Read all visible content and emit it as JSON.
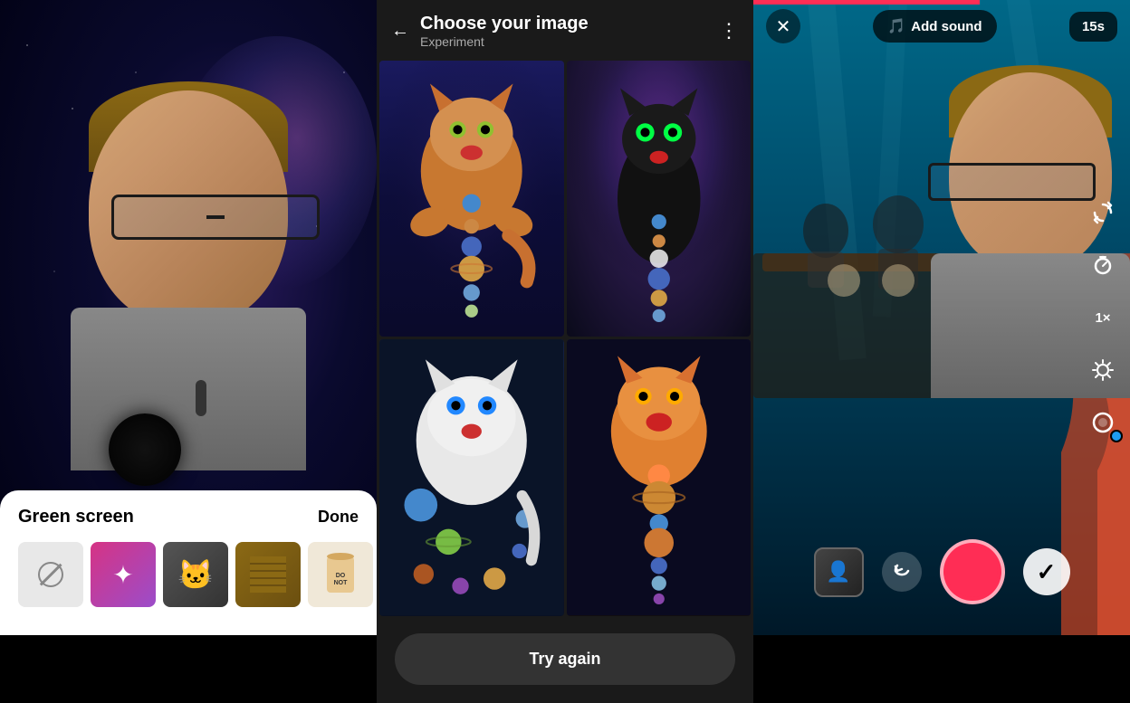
{
  "left": {
    "bottom_sheet": {
      "title": "Green screen",
      "done_label": "Done"
    },
    "thumbnails": [
      {
        "id": "no-bg",
        "type": "none"
      },
      {
        "id": "ai-gen",
        "type": "ai"
      },
      {
        "id": "cat-photo",
        "type": "cat"
      },
      {
        "id": "wood-photo",
        "type": "wood"
      },
      {
        "id": "can-photo",
        "type": "can"
      }
    ]
  },
  "middle": {
    "header": {
      "title": "Choose your image",
      "subtitle": "Experiment",
      "back_label": "←",
      "more_label": "⋮"
    },
    "cats": [
      {
        "id": "cat1",
        "emoji": "🐱",
        "bg": "cat1"
      },
      {
        "id": "cat2",
        "emoji": "🐈‍⬛",
        "bg": "cat2"
      },
      {
        "id": "cat3",
        "emoji": "🐱",
        "bg": "cat3"
      },
      {
        "id": "cat4",
        "emoji": "🐈",
        "bg": "cat4"
      }
    ],
    "try_again_label": "Try again"
  },
  "right": {
    "close_label": "✕",
    "add_sound_label": "Add sound",
    "timer_label": "15s",
    "sidebar_icons": [
      {
        "id": "flip",
        "icon": "↺"
      },
      {
        "id": "timer",
        "icon": "⏱"
      },
      {
        "id": "speed",
        "icon": "1×"
      },
      {
        "id": "effects",
        "icon": "✦"
      },
      {
        "id": "beauty",
        "icon": "●"
      }
    ],
    "record_btn_label": "Record",
    "check_btn_label": "✓"
  }
}
